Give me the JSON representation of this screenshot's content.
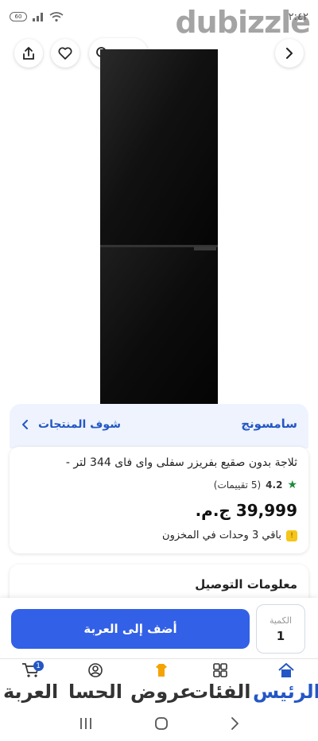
{
  "status_bar": {
    "time": "٢:٤٢",
    "battery": "60"
  },
  "watermark": "dubizzle",
  "top_bar": {
    "search_label": "بحث"
  },
  "seller": {
    "name": "سامسونج",
    "see_products": "شوف المنتجات"
  },
  "product": {
    "title": "ثلاجة بدون صقيع بفريزر سفلى واى فاى 344 لتر -",
    "rating_value": "4.2",
    "rating_count": "(5 تقييمات)",
    "price": "39,999 ج.م.",
    "stock": "باقي 3 وحدات في المخزون"
  },
  "delivery": {
    "title": "معلومات التوصيل"
  },
  "action_bar": {
    "add_to_cart": "أضف إلى العربة",
    "quantity_label": "الكمية",
    "quantity_value": "1"
  },
  "bottom_nav": {
    "items": [
      {
        "label": "الرئيس"
      },
      {
        "label": "الفئات"
      },
      {
        "label": "عروض"
      },
      {
        "label": "الحسا"
      },
      {
        "label": "العربة",
        "badge": "1"
      }
    ]
  },
  "colors": {
    "accent": "#3260e6",
    "link": "#2457c5",
    "seller_bg": "#eef3fd",
    "star": "#1a8a3a"
  }
}
